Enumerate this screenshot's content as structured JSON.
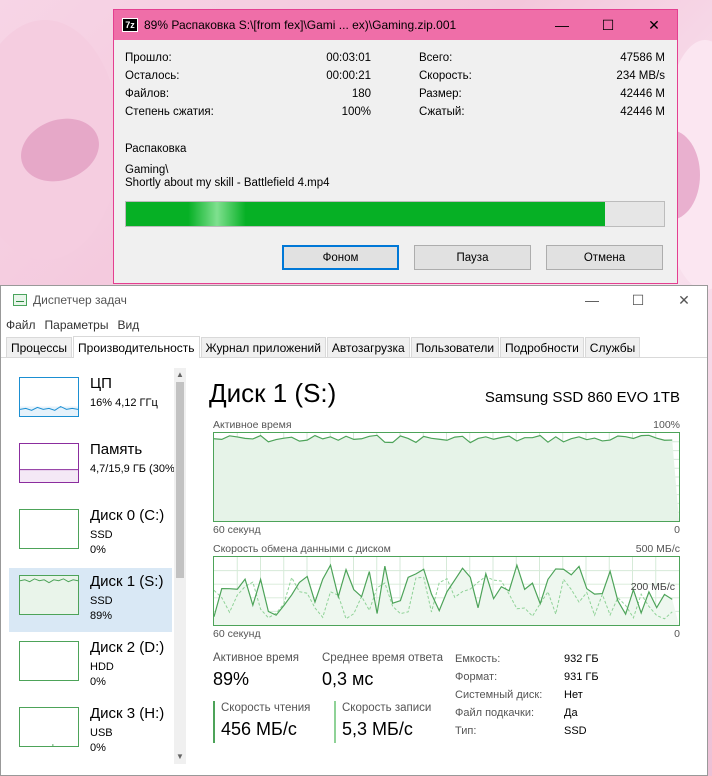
{
  "zip": {
    "logo": "7z",
    "title": "89% Распаковка S:\\[from fex]\\Gami ... ex)\\Gaming.zip.001",
    "stats_left": [
      {
        "label": "Прошло:",
        "value": "00:03:01"
      },
      {
        "label": "Осталось:",
        "value": "00:00:21"
      },
      {
        "label": "Файлов:",
        "value": "180"
      },
      {
        "label": "Степень сжатия:",
        "value": "100%"
      }
    ],
    "stats_right": [
      {
        "label": "Всего:",
        "value": "47586 M"
      },
      {
        "label": "Скорость:",
        "value": "234 MB/s"
      },
      {
        "label": "Размер:",
        "value": "42446 M"
      },
      {
        "label": "Сжатый:",
        "value": "42446 M"
      }
    ],
    "operation": "Распаковка",
    "folder": "Gaming\\",
    "file": "Shortly about my skill - Battlefield 4.mp4",
    "progress_fraction": 0.89,
    "buttons": {
      "background": "Фоном",
      "pause": "Пауза",
      "cancel": "Отмена"
    },
    "title_bar_color": "#ef6ea8",
    "progress_color": "#06b025"
  },
  "taskmgr": {
    "title": "Диспетчер задач",
    "menu": [
      "Файл",
      "Параметры",
      "Вид"
    ],
    "tabs": [
      "Процессы",
      "Производительность",
      "Журнал приложений",
      "Автозагрузка",
      "Пользователи",
      "Подробности",
      "Службы"
    ],
    "active_tab": "Производительность",
    "sidebar": [
      {
        "name": "ЦП",
        "sub1": "16%  4,12 ГГц",
        "sub2": "",
        "color": "#1b8fd2",
        "type": "cpu"
      },
      {
        "name": "Память",
        "sub1": "4,7/15,9 ГБ (30%)",
        "sub2": "",
        "color": "#8b2d9e",
        "type": "mem"
      },
      {
        "name": "Диск 0 (C:)",
        "sub1": "SSD",
        "sub2": "0%",
        "color": "#4da359",
        "type": "flat"
      },
      {
        "name": "Диск 1 (S:)",
        "sub1": "SSD",
        "sub2": "89%",
        "color": "#4da359",
        "type": "busy"
      },
      {
        "name": "Диск 2 (D:)",
        "sub1": "HDD",
        "sub2": "0%",
        "color": "#4da359",
        "type": "flat"
      },
      {
        "name": "Диск 3 (H:)",
        "sub1": "USB",
        "sub2": "0%",
        "color": "#4da359",
        "type": "flat"
      }
    ],
    "disk": {
      "title": "Диск 1 (S:)",
      "model": "Samsung SSD 860 EVO 1TB",
      "active_graph": {
        "label": "Активное время",
        "max": "100%",
        "xlabel": "60 секунд",
        "min": "0"
      },
      "transfer_graph": {
        "label": "Скорость обмена данными с диском",
        "max": "500 МБ/с",
        "mid": "200 МБ/с",
        "xlabel": "60 секунд",
        "min": "0"
      },
      "stats": {
        "active_time_label": "Активное время",
        "active_time": "89%",
        "response_label": "Среднее время ответа",
        "response": "0,3 мс",
        "read_label": "Скорость чтения",
        "read": "456 МБ/с",
        "write_label": "Скорость записи",
        "write": "5,3 МБ/с"
      },
      "properties": [
        {
          "key": "Емкость:",
          "value": "932 ГБ"
        },
        {
          "key": "Формат:",
          "value": "931 ГБ"
        },
        {
          "key": "Системный диск:",
          "value": "Нет"
        },
        {
          "key": "Файл подкачки:",
          "value": "Да"
        },
        {
          "key": "Тип:",
          "value": "SSD"
        }
      ]
    },
    "graph_color": "#4da359"
  }
}
